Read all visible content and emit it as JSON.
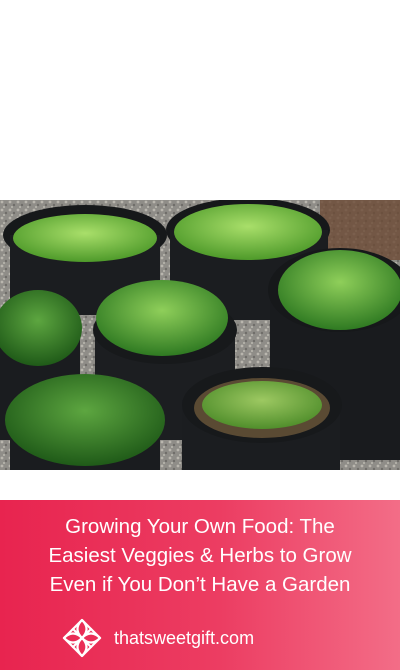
{
  "banner": {
    "headline_lines": [
      "Growing Your Own Food: The",
      "Easiest Veggies & Herbs to Grow",
      "Even if You Don’t Have a Garden"
    ],
    "site": "thatsweetgift.com",
    "logo_icon": "gift-ribbon-icon"
  },
  "colors": {
    "banner_start": "#e8244f",
    "banner_end": "#f36d87",
    "text": "#ffffff"
  }
}
